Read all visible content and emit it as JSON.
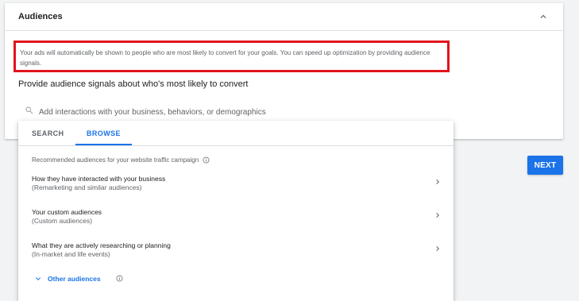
{
  "card": {
    "title": "Audiences",
    "info_text": "Your ads will automatically be shown to people who are most likely to convert for your goals. You can speed up optimization by providing audience signals.",
    "signals_heading": "Provide audience signals about who's most likely to convert"
  },
  "search": {
    "placeholder": "Add interactions with your business, behaviors, or demographics",
    "value": ""
  },
  "next_button": {
    "label": "NEXT"
  },
  "dropdown": {
    "tabs": [
      {
        "label": "SEARCH",
        "active": false
      },
      {
        "label": "BROWSE",
        "active": true
      }
    ],
    "recommended_label": "Recommended audiences for your website traffic campaign",
    "rows": [
      {
        "title": "How they have interacted with your business",
        "subtitle": "(Remarketing and similar audiences)"
      },
      {
        "title": "Your custom audiences",
        "subtitle": "(Custom audiences)"
      },
      {
        "title": "What they are actively researching or planning",
        "subtitle": "(In-market and life events)"
      }
    ],
    "other_audiences_label": "Other audiences"
  },
  "icons": {
    "collapse": "chevron-up-icon",
    "search": "search-icon",
    "info": "info-icon",
    "row_chevron": "chevron-right-icon",
    "expand": "chevron-down-icon"
  },
  "colors": {
    "accent": "#1a73e8",
    "highlight_border": "#e0141c",
    "text_primary": "#202124",
    "text_secondary": "#5f6368"
  }
}
